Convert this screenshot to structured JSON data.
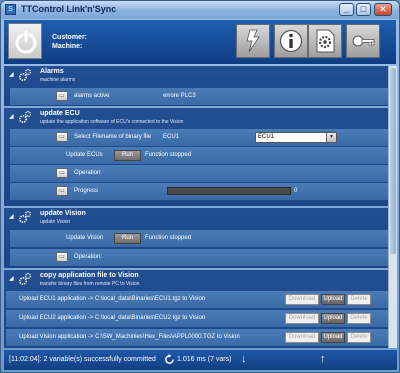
{
  "window": {
    "title": "TTControl Link'n'Sync",
    "app_icon": "S",
    "buttons": {
      "minimize": "_",
      "maximize": "□",
      "close": "✕"
    }
  },
  "header": {
    "customer_label": "Customer:",
    "machine_label": "Machine:",
    "tools": [
      "flash-icon",
      "info-icon",
      "settings-document-icon",
      "key-icon"
    ]
  },
  "sections": {
    "alarms": {
      "title": "Alarms",
      "subtitle": "machine alarms",
      "row": {
        "label": "alarms active",
        "value": "errore PLC3"
      }
    },
    "ecu": {
      "title": "update ECU",
      "subtitle": "update the application software of ECU's connected to the Vision",
      "select_label": "Select Filename of binary file",
      "select_inline": "ECU1",
      "select_value": "ECU1",
      "update_label": "Update ECUs",
      "run_label": "Run",
      "run_status": "Function stopped",
      "operation_label": "Operation:",
      "progress_label": "Progress",
      "progress_value": "0",
      "progress_fraction": 0
    },
    "vision": {
      "title": "update Vision",
      "subtitle": "update Vision",
      "update_label": "Update Vision",
      "run_label": "Run",
      "run_status": "Function stopped",
      "operation_label": "Operation:"
    },
    "copy": {
      "title": "copy application file to Vision",
      "subtitle": "transfer binary files from remote PC to Vision",
      "rows": [
        {
          "label": "Upload ECU1 application -> C:\\local_data\\Binaries\\ECU1.tgz to Vision"
        },
        {
          "label": "Upload ECU2 application -> C:\\local_data\\Binaries\\ECU2.tgz to Vision"
        },
        {
          "label": "Upload Vision application -> C:\\SW_Machinies\\Hex_Files\\APPL0000.TGZ to Vision"
        }
      ],
      "download_label": "Download",
      "upload_label": "Upload",
      "delete_label": "Delete"
    }
  },
  "status": {
    "message": "[11:02:04]: 2 variable(s) successfully committed",
    "timing": "1.016 ms (7 vars)",
    "down_arrow": "↓",
    "up_arrow": "↑"
  },
  "colors": {
    "header_blue": "#1f5fb0",
    "section_blue": "#234f92",
    "row_blue": "#4c7cb8",
    "progress_green": "#3fb04a"
  }
}
